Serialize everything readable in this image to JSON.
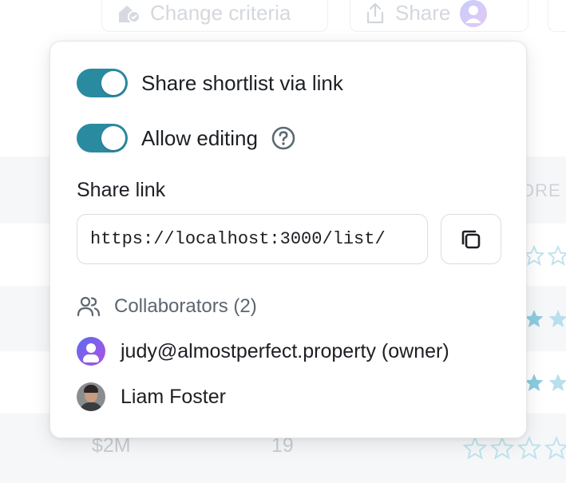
{
  "background": {
    "change_criteria_label": "Change criteria",
    "share_label": "Share",
    "score_column_label": "ORE",
    "price": "$2M",
    "count": "19"
  },
  "popover": {
    "share_toggle_label": "Share shortlist via link",
    "share_toggle_on": true,
    "edit_toggle_label": "Allow editing",
    "edit_toggle_on": true,
    "share_link_label": "Share link",
    "share_link_value": "https://localhost:3000/list/",
    "collaborators_label": "Collaborators (2)",
    "collaborators": [
      {
        "name": "judy@almostperfect.property (owner)",
        "avatar": "gradient-user-avatar"
      },
      {
        "name": "Liam Foster",
        "avatar": "photo-avatar"
      }
    ]
  },
  "colors": {
    "toggle_on": "#2a8aa0",
    "star_outline": "#bfe3ee",
    "star_filled": "#8ccbe0"
  }
}
